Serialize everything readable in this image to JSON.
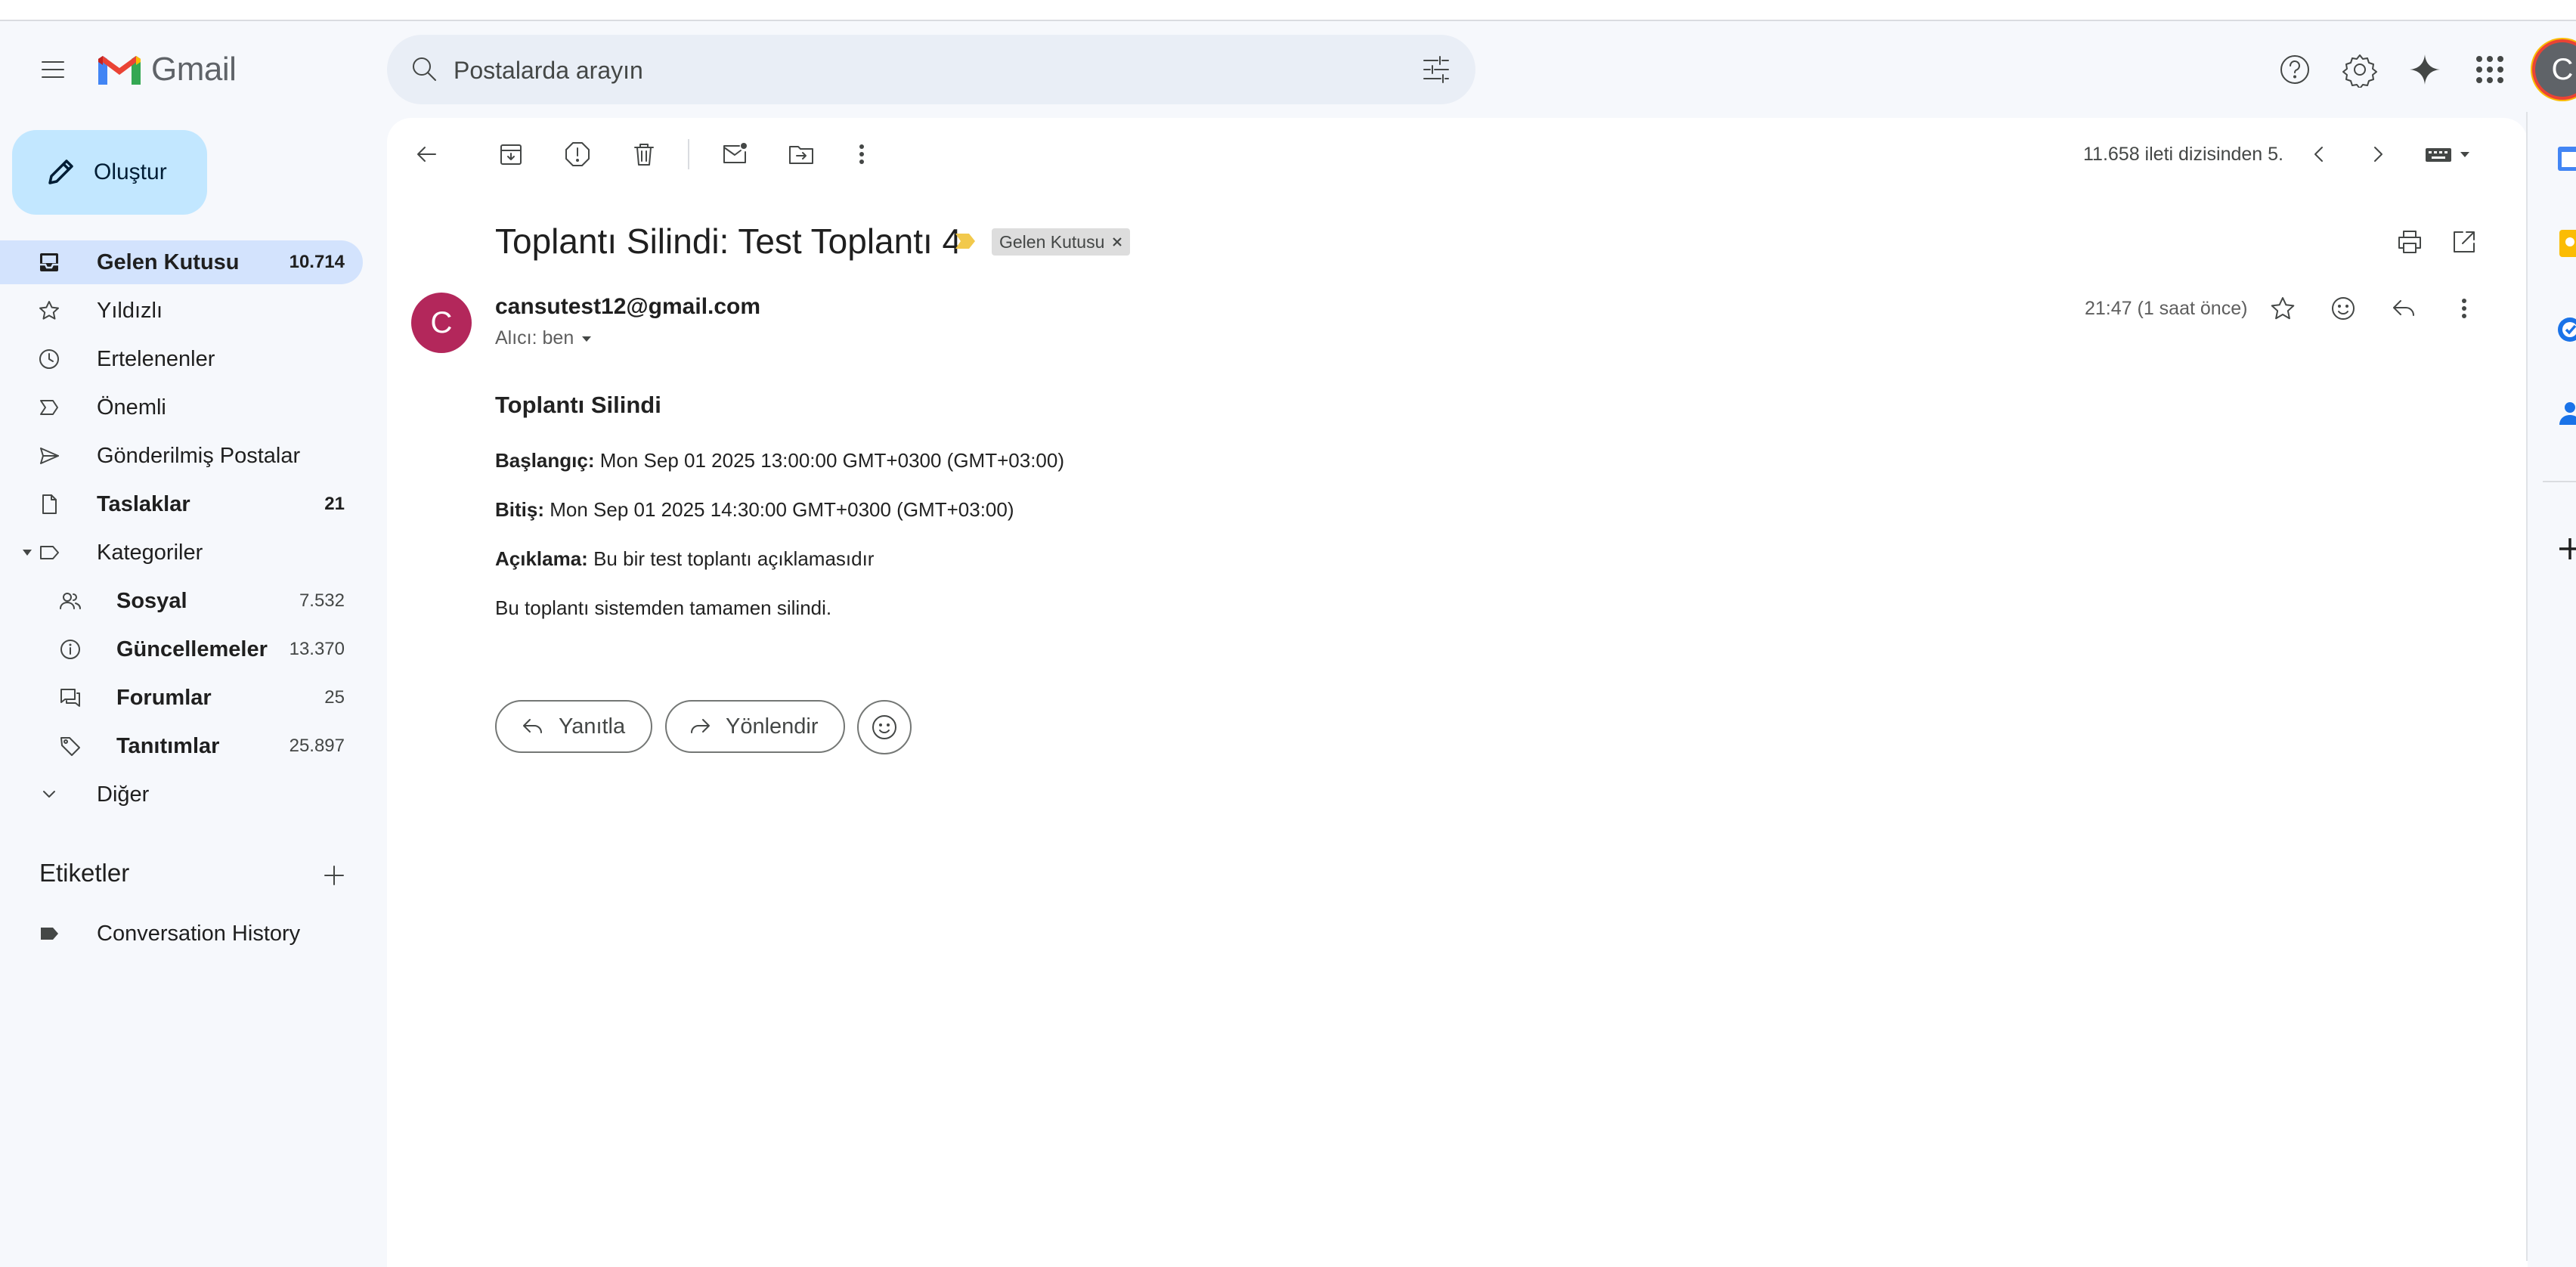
{
  "app": {
    "name": "Gmail"
  },
  "search": {
    "placeholder": "Postalarda arayın"
  },
  "header": {
    "account_initial": "C"
  },
  "compose": {
    "label": "Oluştur"
  },
  "sidebar": {
    "items": [
      {
        "label": "Gelen Kutusu",
        "count": "10.714",
        "icon": "inbox-icon"
      },
      {
        "label": "Yıldızlı",
        "count": "",
        "icon": "star-icon"
      },
      {
        "label": "Ertelenenler",
        "count": "",
        "icon": "clock-icon"
      },
      {
        "label": "Önemli",
        "count": "",
        "icon": "important-icon"
      },
      {
        "label": "Gönderilmiş Postalar",
        "count": "",
        "icon": "send-icon"
      },
      {
        "label": "Taslaklar",
        "count": "21",
        "icon": "draft-icon"
      },
      {
        "label": "Kategoriler",
        "count": "",
        "icon": "label-icon"
      }
    ],
    "categories": [
      {
        "label": "Sosyal",
        "count": "7.532",
        "icon": "people-icon"
      },
      {
        "label": "Güncellemeler",
        "count": "13.370",
        "icon": "info-icon"
      },
      {
        "label": "Forumlar",
        "count": "25",
        "icon": "forum-icon"
      },
      {
        "label": "Tanıtımlar",
        "count": "25.897",
        "icon": "tag-icon"
      }
    ],
    "more_label": "Diğer",
    "labels_title": "Etiketler",
    "user_labels": [
      {
        "label": "Conversation History"
      }
    ]
  },
  "toolbar": {
    "pager_text": "11.658 ileti dizisinden 5."
  },
  "email": {
    "subject": "Toplantı Silindi: Test Toplantı 4",
    "label_chip": "Gelen Kutusu",
    "sender_initial": "C",
    "sender": "cansutest12@gmail.com",
    "to_line": "Alıcı: ben",
    "time": "21:47 (1 saat önce)",
    "body": {
      "title": "Toplantı Silindi",
      "start_label": "Başlangıç:",
      "start_value": "Mon Sep 01 2025 13:00:00 GMT+0300 (GMT+03:00)",
      "end_label": "Bitiş:",
      "end_value": "Mon Sep 01 2025 14:30:00 GMT+0300 (GMT+03:00)",
      "desc_label": "Açıklama:",
      "desc_value": "Bu bir test toplantı açıklamasıdır",
      "note": "Bu toplantı sistemden tamamen silindi."
    },
    "reply_label": "Yanıtla",
    "forward_label": "Yönlendir"
  },
  "colors": {
    "accent": "#c2e7ff",
    "active_nav": "#d3e3fd",
    "sender_avatar": "#b3275b",
    "background": "#f6f8fc"
  }
}
